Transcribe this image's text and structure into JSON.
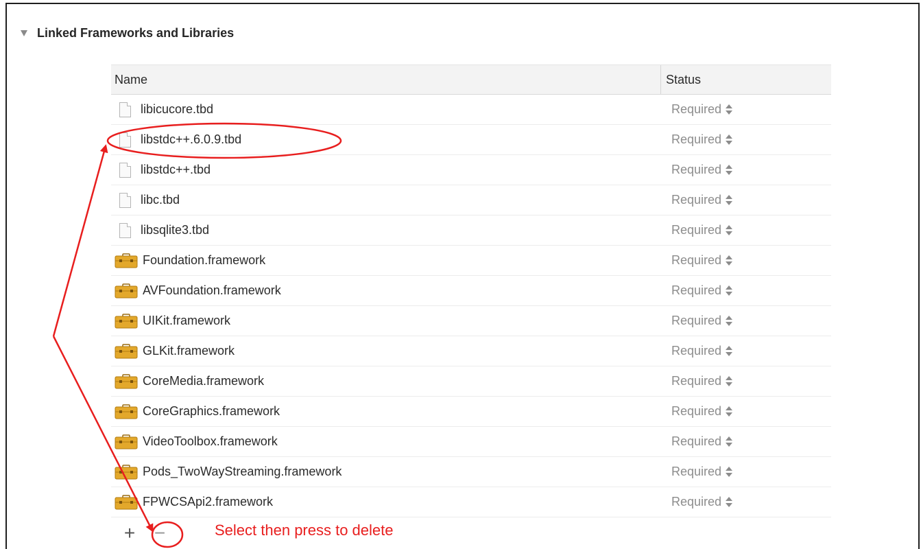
{
  "section": {
    "title": "Linked Frameworks and Libraries"
  },
  "table": {
    "columns": {
      "name": "Name",
      "status": "Status"
    },
    "rows": [
      {
        "name": "libicucore.tbd",
        "status": "Required",
        "icon": "file-icon"
      },
      {
        "name": "libstdc++.6.0.9.tbd",
        "status": "Required",
        "icon": "file-icon"
      },
      {
        "name": "libstdc++.tbd",
        "status": "Required",
        "icon": "file-icon"
      },
      {
        "name": "libc.tbd",
        "status": "Required",
        "icon": "file-icon"
      },
      {
        "name": "libsqlite3.tbd",
        "status": "Required",
        "icon": "file-icon"
      },
      {
        "name": "Foundation.framework",
        "status": "Required",
        "icon": "framework-icon"
      },
      {
        "name": "AVFoundation.framework",
        "status": "Required",
        "icon": "framework-icon"
      },
      {
        "name": "UIKit.framework",
        "status": "Required",
        "icon": "framework-icon"
      },
      {
        "name": "GLKit.framework",
        "status": "Required",
        "icon": "framework-icon"
      },
      {
        "name": "CoreMedia.framework",
        "status": "Required",
        "icon": "framework-icon"
      },
      {
        "name": "CoreGraphics.framework",
        "status": "Required",
        "icon": "framework-icon"
      },
      {
        "name": "VideoToolbox.framework",
        "status": "Required",
        "icon": "framework-icon"
      },
      {
        "name": "Pods_TwoWayStreaming.framework",
        "status": "Required",
        "icon": "framework-icon"
      },
      {
        "name": "FPWCSApi2.framework",
        "status": "Required",
        "icon": "framework-icon"
      }
    ]
  },
  "toolbar": {
    "add_label": "+",
    "remove_label": "−"
  },
  "annotation": {
    "text": "Select then press to delete",
    "color": "#e81e1e"
  },
  "colors": {
    "framework_icon": "#e3a82b",
    "status_text": "#8c8c8c"
  }
}
